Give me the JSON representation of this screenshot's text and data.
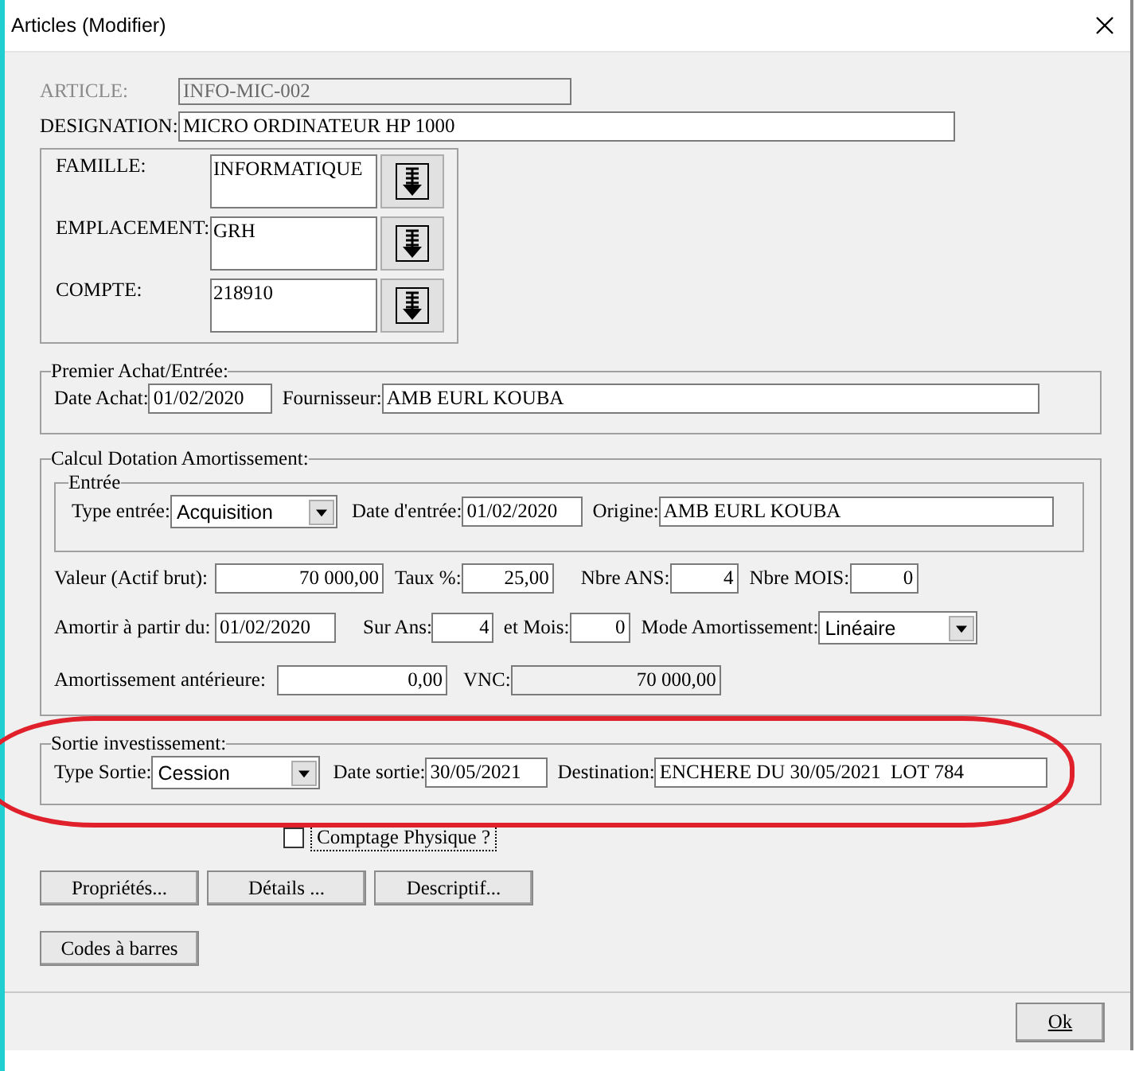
{
  "window": {
    "title": "Articles  (Modifier)"
  },
  "article": {
    "label": "ARTICLE:",
    "value": "INFO-MIC-002",
    "disabled": true
  },
  "designation": {
    "label": "DESIGNATION:",
    "value": "MICRO ORDINATEUR HP 1000"
  },
  "lookups": [
    {
      "label": "FAMILLE:",
      "value": "INFORMATIQUE"
    },
    {
      "label": "EMPLACEMENT:",
      "value": "GRH"
    },
    {
      "label": "COMPTE:",
      "value": "218910"
    }
  ],
  "premier_achat": {
    "title": "Premier Achat/Entrée:",
    "date_label": "Date Achat:",
    "date": "01/02/2020",
    "supplier_label": "Fournisseur:",
    "supplier": "AMB EURL KOUBA"
  },
  "calcul": {
    "title": "Calcul Dotation Amortissement:",
    "entree": {
      "title": "Entrée",
      "type_label": "Type entrée:",
      "type": "Acquisition",
      "date_label": "Date d'entrée:",
      "date": "01/02/2020",
      "origin_label": "Origine:",
      "origin": "AMB EURL KOUBA"
    },
    "valeur_label": "Valeur (Actif brut):",
    "valeur": "70 000,00",
    "taux_label": "Taux %:",
    "taux": "25,00",
    "ans_label": "Nbre ANS:",
    "ans": "4",
    "mois_label": "Nbre MOIS:",
    "mois": "0",
    "from_label": "Amortir à partir du:",
    "from": "01/02/2020",
    "sur_ans_label": "Sur Ans:",
    "sur_ans": "4",
    "et_mois_label": "et Mois:",
    "et_mois": "0",
    "mode_label": "Mode Amortissement:",
    "mode": "Linéaire",
    "anterieur_label": "Amortissement antérieure:",
    "anterieur": "0,00",
    "vnc_label": "VNC:",
    "vnc": "70 000,00"
  },
  "sortie": {
    "title": "Sortie investissement:",
    "type_label": "Type Sortie:",
    "type": "Cession",
    "date_label": "Date sortie:",
    "date": "30/05/2021",
    "dest_label": "Destination:",
    "dest": "ENCHERE DU 30/05/2021  LOT 784",
    "highlighted": true
  },
  "comptage": {
    "label": "Comptage Physique ?",
    "checked": false
  },
  "buttons": [
    "Propriétés...",
    "Détails ...",
    "Descriptif..."
  ],
  "barcode_button": "Codes à barres",
  "ok_button": "Ok"
}
